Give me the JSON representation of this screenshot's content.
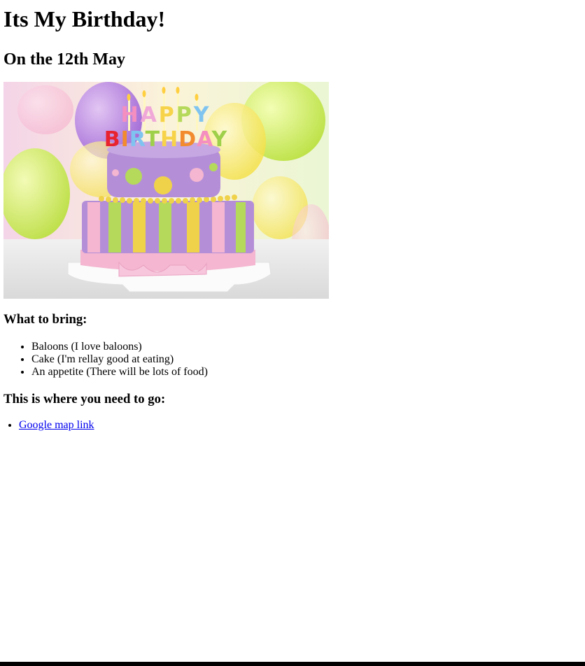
{
  "page": {
    "title": "Its My Birthday!",
    "subtitle": "On the 12th May"
  },
  "hero_image": {
    "banner_top": "HAPPY",
    "banner_bottom": "BIRTHDAY",
    "colors": {
      "cake_purple": "#b48fd8",
      "cake_pink": "#f4b6d0",
      "cake_yellow": "#f0d24a",
      "cake_green": "#b5d95a"
    }
  },
  "bring": {
    "heading": "What to bring:",
    "items": [
      "Baloons (I love baloons)",
      "Cake (I'm rellay good at eating)",
      "An appetite (There will be lots of food)"
    ]
  },
  "directions": {
    "heading": "This is where you need to go:",
    "link_text": "Google map link"
  },
  "colors": {
    "link": "#0000ee",
    "text": "#000000",
    "background": "#ffffff"
  }
}
